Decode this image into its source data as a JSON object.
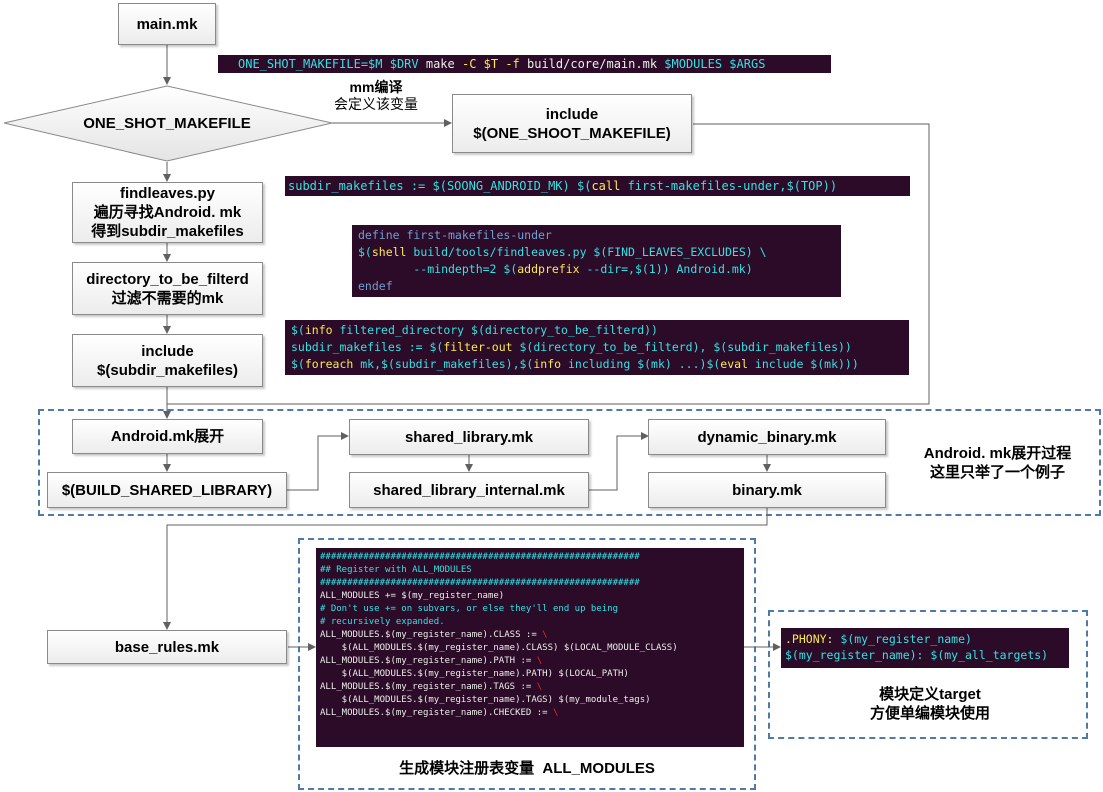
{
  "boxes": {
    "main_mk": "main.mk",
    "one_shot_diamond": "ONE_SHOT_MAKEFILE",
    "include_one_shoot": [
      "include",
      "$(ONE_SHOOT_MAKEFILE)"
    ],
    "findleaves": [
      "findleaves.py",
      "遍历寻找Android. mk",
      "得到subdir_makefiles"
    ],
    "directory_filter": [
      "directory_to_be_filterd",
      "过滤不需要的mk"
    ],
    "include_subdir": [
      "include",
      "$(subdir_makefiles)"
    ],
    "android_mk_expand": "Android.mk展开",
    "build_shared_library": "$(BUILD_SHARED_LIBRARY)",
    "shared_library_mk": "shared_library.mk",
    "shared_library_internal_mk": "shared_library_internal.mk",
    "dynamic_binary_mk": "dynamic_binary.mk",
    "binary_mk": "binary.mk",
    "base_rules_mk": "base_rules.mk"
  },
  "labels": {
    "mm_note": [
      "mm编译",
      "会定义该变量"
    ],
    "android_expand_note": [
      "Android. mk展开过程",
      "这里只举了一个例子"
    ],
    "all_modules_caption": "生成模块注册表变量  ALL_MODULES",
    "target_caption": [
      "模块定义target",
      "方便单编模块使用"
    ]
  },
  "code": {
    "one_shot": {
      "p1": "ONE_SHOT_MAKEFILE=$M $DRV ",
      "p2": "make ",
      "p3": "-C $T -f ",
      "p4": "build/core/main.mk ",
      "p5": "$MODULES $ARGS"
    },
    "subdir": {
      "p1": "subdir_makefiles := $(SOONG_ANDROID_MK) $(",
      "p2": "call",
      "p3": " first-makefiles-under,$(TOP))"
    },
    "define": {
      "l1": "define first-makefiles-under",
      "l2a": "$(",
      "l2b": "shell",
      "l2c": " build/tools/findleaves.py $(FIND_LEAVES_EXCLUDES) \\",
      "l3a": "        --mindepth=2 $(",
      "l3b": "addprefix",
      "l3c": " --dir=,$(1)) Android.mk)",
      "l4": "endef"
    },
    "filter": {
      "l1a": "$(",
      "l1b": "info",
      "l1c": " filtered_directory $(directory_to_be_filterd))",
      "l2a": "subdir_makefiles := $(",
      "l2b": "filter-out",
      "l2c": " $(directory_to_be_filterd), $(subdir_makefiles))",
      "l3a": "$(",
      "l3b": "foreach",
      "l3c": " mk,$(subdir_makefiles),$(",
      "l3d": "info",
      "l3e": " including $(mk) ...)$(",
      "l3f": "eval",
      "l3g": " include $(mk)))"
    },
    "all_modules": {
      "l1": "###########################################################",
      "l2": "## Register with ALL_MODULES",
      "l3": "###########################################################",
      "l4": "",
      "l5": "ALL_MODULES += $(my_register_name)",
      "l6": "",
      "l7": "# Don't use += on subvars, or else they'll end up being",
      "l8": "# recursively expanded.",
      "l9a": "ALL_MODULES.$(my_register_name).CLASS := ",
      "l10": "    $(ALL_MODULES.$(my_register_name).CLASS) $(LOCAL_MODULE_CLASS)",
      "l11a": "ALL_MODULES.$(my_register_name).PATH := ",
      "l12": "    $(ALL_MODULES.$(my_register_name).PATH) $(LOCAL_PATH)",
      "l13a": "ALL_MODULES.$(my_register_name).TAGS := ",
      "l14": "    $(ALL_MODULES.$(my_register_name).TAGS) $(my_module_tags)",
      "l15a": "ALL_MODULES.$(my_register_name).CHECKED := ",
      "backslash": "\\"
    },
    "phony": {
      "l1a": ".PHONY:",
      "l1b": " $(my_register_name)",
      "l2": "$(my_register_name): $(my_all_targets)"
    }
  },
  "colors": {
    "code_bg": "#2b0b28",
    "code_cyan": "#34e2e2",
    "code_yellow": "#fce94f",
    "code_red": "#ef2929",
    "code_blue": "#729fcf",
    "dashed_border": "#4f7aa7",
    "connector": "#606060"
  }
}
